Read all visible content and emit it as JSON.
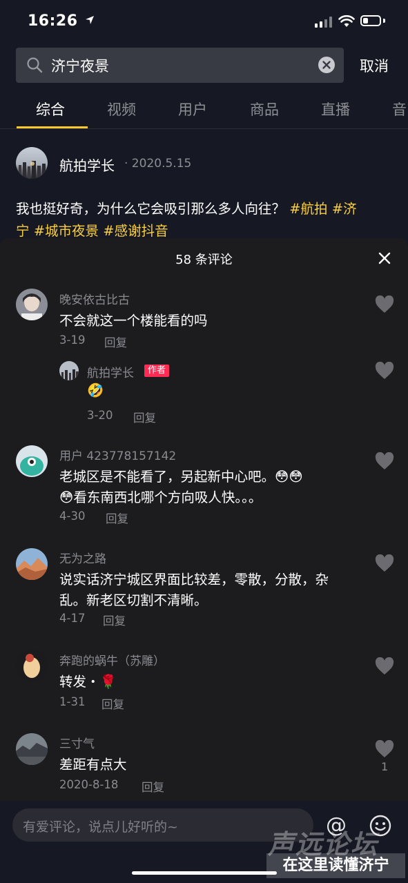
{
  "status_bar": {
    "time": "16:26",
    "battery_level": 0.3
  },
  "search": {
    "query": "济宁夜景",
    "cancel_label": "取消"
  },
  "tabs": [
    {
      "label": "综合",
      "active": true
    },
    {
      "label": "视频",
      "active": false
    },
    {
      "label": "用户",
      "active": false
    },
    {
      "label": "商品",
      "active": false
    },
    {
      "label": "直播",
      "active": false
    },
    {
      "label": "音",
      "active": false
    }
  ],
  "post": {
    "author": "航拍学长",
    "date": "· 2020.5.15",
    "line1_text": "我也挺好奇，为什么它会吸引那么多人向往？",
    "line1_tags": "#航拍 #济",
    "line2_tags": "宁 #城市夜景 #感谢抖音"
  },
  "comments_panel": {
    "title": "58 条评论",
    "reply_label": "回复",
    "author_badge": "作者",
    "comments": [
      {
        "name": "晚安依古比古",
        "lines": [
          "不会就这一个楼能看的吗"
        ],
        "date": "3-19"
      },
      {
        "name": "航拍学长",
        "lines": [
          "🤣"
        ],
        "date": "3-20",
        "is_reply": true,
        "is_author": true
      },
      {
        "name": "用户 423778157142",
        "lines": [
          "老城区是不能看了，另起新中心吧。😳😳",
          "😳看东南西北哪个方向吸人快。。。"
        ],
        "date": "4-30"
      },
      {
        "name": "无为之路",
        "lines": [
          "说实话济宁城区界面比较差，零散，分散，杂",
          "乱。新老区切割不清晰。"
        ],
        "date": "4-17"
      },
      {
        "name": "奔跑的蜗牛（苏雕）",
        "lines": [
          "转发・🌹"
        ],
        "date": "1-31"
      },
      {
        "name": "三寸气",
        "lines": [
          "差距有点大"
        ],
        "date": "2020-8-18",
        "likes": "1"
      }
    ]
  },
  "input": {
    "placeholder": "有爱评论，说点儿好听的~",
    "at_symbol": "@"
  },
  "watermark": {
    "top": "声远论坛",
    "bottom": "在这里读懂济宁"
  },
  "colors": {
    "background": "#161823",
    "panel": "#1c1c1e",
    "tag": "#facf3d",
    "tab_active": "#fbc929",
    "badge": "#fe2c55"
  }
}
